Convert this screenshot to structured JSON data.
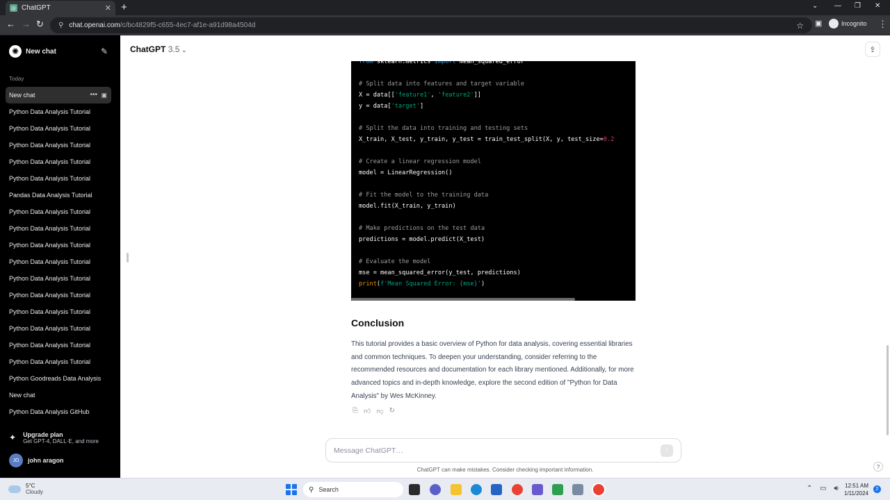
{
  "browser": {
    "tab_title": "ChatGPT",
    "tab_favicon": "chatgpt-icon",
    "url_host": "chat.openai.com",
    "url_path": "/c/bc4829f5-c655-4ec7-af1e-a91d98a4504d",
    "incognito_label": "Incognito"
  },
  "sidebar": {
    "new_chat_label": "New chat",
    "section_today": "Today",
    "items": [
      {
        "label": "New chat"
      },
      {
        "label": "Python Data Analysis Tutorial"
      },
      {
        "label": "Python Data Analysis Tutorial"
      },
      {
        "label": "Python Data Analysis Tutorial"
      },
      {
        "label": "Python Data Analysis Tutorial"
      },
      {
        "label": "Python Data Analysis Tutorial"
      },
      {
        "label": "Pandas Data Analysis Tutorial"
      },
      {
        "label": "Python Data Analysis Tutorial"
      },
      {
        "label": "Python Data Analysis Tutorial"
      },
      {
        "label": "Python Data Analysis Tutorial"
      },
      {
        "label": "Python Data Analysis Tutorial"
      },
      {
        "label": "Python Data Analysis Tutorial"
      },
      {
        "label": "Python Data Analysis Tutorial"
      },
      {
        "label": "Python Data Analysis Tutorial"
      },
      {
        "label": "Python Data Analysis Tutorial"
      },
      {
        "label": "Python Data Analysis Tutorial"
      },
      {
        "label": "Python Data Analysis Tutorial"
      },
      {
        "label": "Python Goodreads Data Analysis"
      },
      {
        "label": "New chat"
      },
      {
        "label": "Python Data Analysis GitHub"
      }
    ],
    "upgrade_title": "Upgrade plan",
    "upgrade_sub": "Get GPT-4, DALL·E, and more",
    "user_initials": "JO",
    "user_name": "john aragon"
  },
  "header": {
    "model_name": "ChatGPT",
    "model_version": "3.5"
  },
  "code_lines": [
    "from sklearn.metrics import mean_squared_error",
    "# Split data into features and target variable",
    "X = data[['feature1', 'feature2']]",
    "y = data['target']",
    "# Split the data into training and testing sets",
    "X_train, X_test, y_train, y_test = train_test_split(X, y, test_size=0.2",
    "# Create a linear regression model",
    "model = LinearRegression()",
    "# Fit the model to the training data",
    "model.fit(X_train, y_train)",
    "# Make predictions on the test data",
    "predictions = model.predict(X_test)",
    "# Evaluate the model",
    "mse = mean_squared_error(y_test, predictions)",
    "print(f'Mean Squared Error: {mse}')"
  ],
  "message": {
    "heading": "Conclusion",
    "paragraph": "This tutorial provides a basic overview of Python for data analysis, covering essential libraries and common techniques. To deepen your understanding, consider referring to the recommended resources and documentation for each library mentioned. Additionally, for more advanced topics and in-depth knowledge, explore the second edition of \"Python for Data Analysis\" by Wes McKinney."
  },
  "composer": {
    "placeholder": "Message ChatGPT…"
  },
  "disclaimer": "ChatGPT can make mistakes. Consider checking important information.",
  "taskbar": {
    "temperature": "5°C",
    "weather": "Cloudy",
    "search_label": "Search",
    "time": "12:51 AM",
    "date": "1/11/2024"
  },
  "colors": {
    "sidebar_bg": "#000000",
    "code_bg": "#000000",
    "code_comment": "#9e9e9e",
    "code_keyword": "#2e95d3",
    "code_string": "#00a67d",
    "code_number": "#df3079"
  }
}
